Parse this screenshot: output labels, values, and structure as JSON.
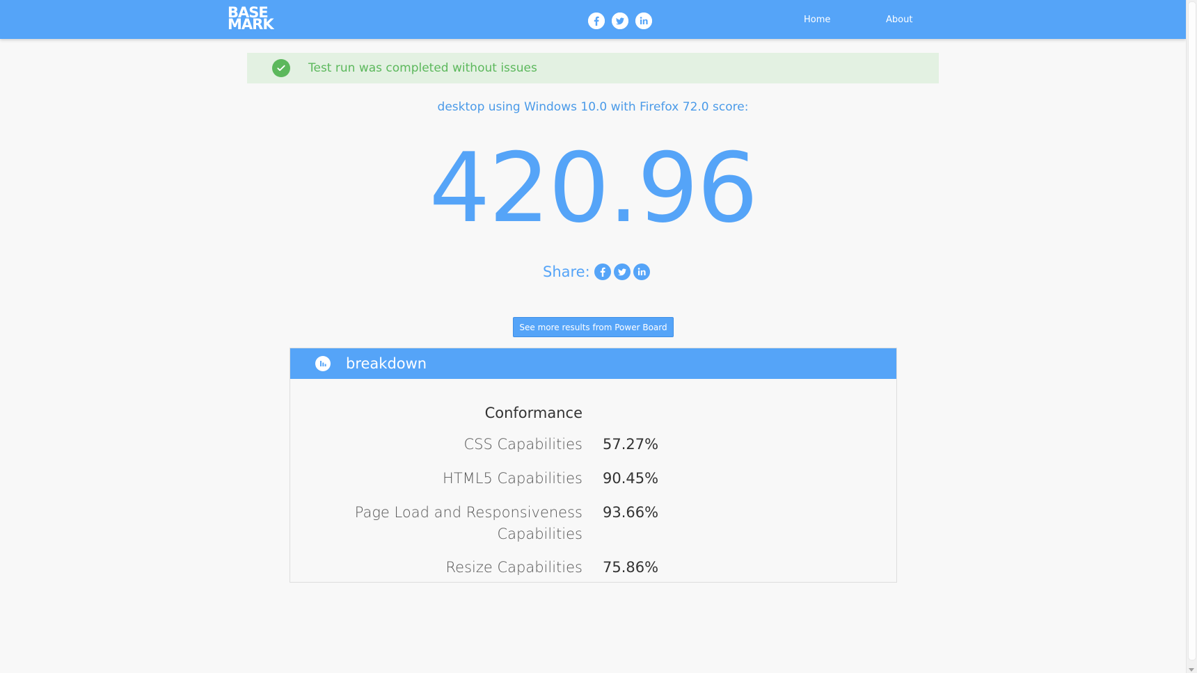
{
  "nav": {
    "logo_line1": "BASE",
    "logo_line2": "MARK",
    "social_icons": [
      "facebook-icon",
      "twitter-icon",
      "linkedin-icon"
    ],
    "links": {
      "home": "Home",
      "about": "About"
    }
  },
  "alert": {
    "text": "Test run was completed without issues",
    "icon": "check-circle-icon"
  },
  "score": {
    "caption": "desktop using Windows 10.0 with Firefox 72.0 score:",
    "value": "420.96"
  },
  "share": {
    "label": "Share:",
    "icons": [
      "facebook-icon",
      "twitter-icon",
      "linkedin-icon"
    ]
  },
  "power_board_button": "See more results from Power Board",
  "breakdown": {
    "title": "breakdown",
    "icon": "bar-chart-icon",
    "section": "Conformance",
    "rows": [
      {
        "label": "CSS Capabilities",
        "value": "57.27%"
      },
      {
        "label": "HTML5 Capabilities",
        "value": "90.45%"
      },
      {
        "label": "Page Load and Responsiveness Capabilities",
        "value": "93.66%"
      },
      {
        "label": "Resize Capabilities",
        "value": "75.86%"
      }
    ]
  },
  "colors": {
    "brand_blue": "#55a4f8",
    "success_green": "#5cb85c",
    "alert_bg": "#e3f1e2"
  }
}
